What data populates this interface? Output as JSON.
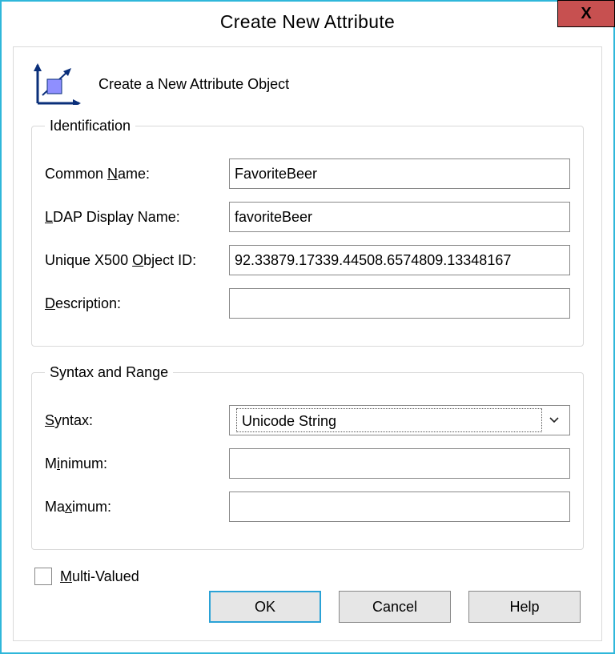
{
  "window": {
    "title": "Create New Attribute",
    "close_icon": "X"
  },
  "header": {
    "subtitle": "Create a New Attribute Object"
  },
  "identification": {
    "legend": "Identification",
    "common_name_label_pre": "Common ",
    "common_name_label_u": "N",
    "common_name_label_post": "ame:",
    "common_name_value": "FavoriteBeer",
    "ldap_label_u": "L",
    "ldap_label_post": "DAP Display Name:",
    "ldap_value": "favoriteBeer",
    "oid_label_pre": "Unique X500 ",
    "oid_label_u": "O",
    "oid_label_post": "bject ID:",
    "oid_value": "92.33879.17339.44508.6574809.13348167",
    "desc_label_u": "D",
    "desc_label_post": "escription:",
    "desc_value": ""
  },
  "syntax_range": {
    "legend": "Syntax and Range",
    "syntax_label_u": "S",
    "syntax_label_post": "yntax:",
    "syntax_value": "Unicode String",
    "min_label_pre": "M",
    "min_label_u": "i",
    "min_label_post": "nimum:",
    "min_value": "",
    "max_label_pre": "Ma",
    "max_label_u": "x",
    "max_label_post": "imum:",
    "max_value": ""
  },
  "multivalued": {
    "label_u": "M",
    "label_post": "ulti-Valued",
    "checked": false
  },
  "buttons": {
    "ok": "OK",
    "cancel": "Cancel",
    "help": "Help"
  }
}
